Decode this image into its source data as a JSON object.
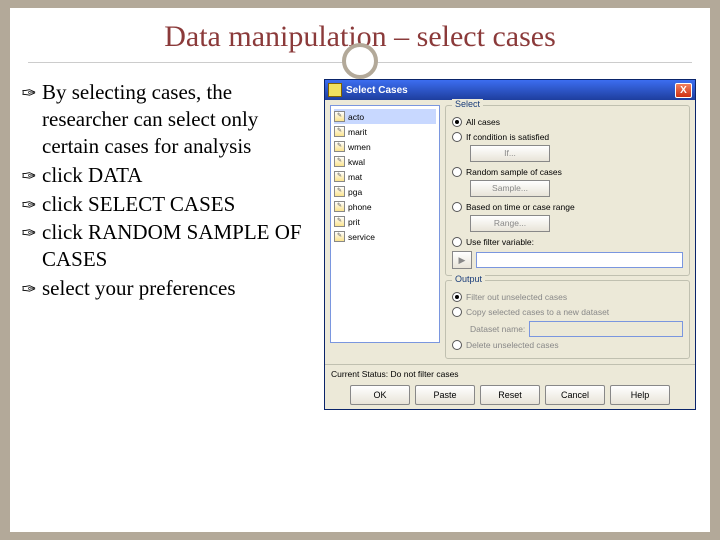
{
  "title": "Data manipulation – select cases",
  "bullets": [
    "By selecting cases, the researcher can select only certain cases for analysis",
    "click DATA",
    "click SELECT CASES",
    "click RANDOM SAMPLE OF CASES",
    "select your preferences"
  ],
  "dialog": {
    "title": "Select Cases",
    "close": "X",
    "vars": [
      "acto",
      "marit",
      "wmen",
      "kwal",
      "mat",
      "pga",
      "phone",
      "prit",
      "service"
    ],
    "group_select": "Select",
    "opt_all": "All cases",
    "opt_cond": "If condition is satisfied",
    "btn_if": "If...",
    "opt_random": "Random sample of cases",
    "btn_sample": "Sample...",
    "opt_range": "Based on time or case range",
    "btn_range": "Range...",
    "opt_filter": "Use filter variable:",
    "group_output": "Output",
    "out_filter": "Filter out unselected cases",
    "out_copy": "Copy selected cases to a new dataset",
    "dataset_label": "Dataset name:",
    "out_delete": "Delete unselected cases",
    "status": "Current Status: Do not filter cases",
    "btn_ok": "OK",
    "btn_paste": "Paste",
    "btn_reset": "Reset",
    "btn_cancel": "Cancel",
    "btn_help": "Help"
  }
}
